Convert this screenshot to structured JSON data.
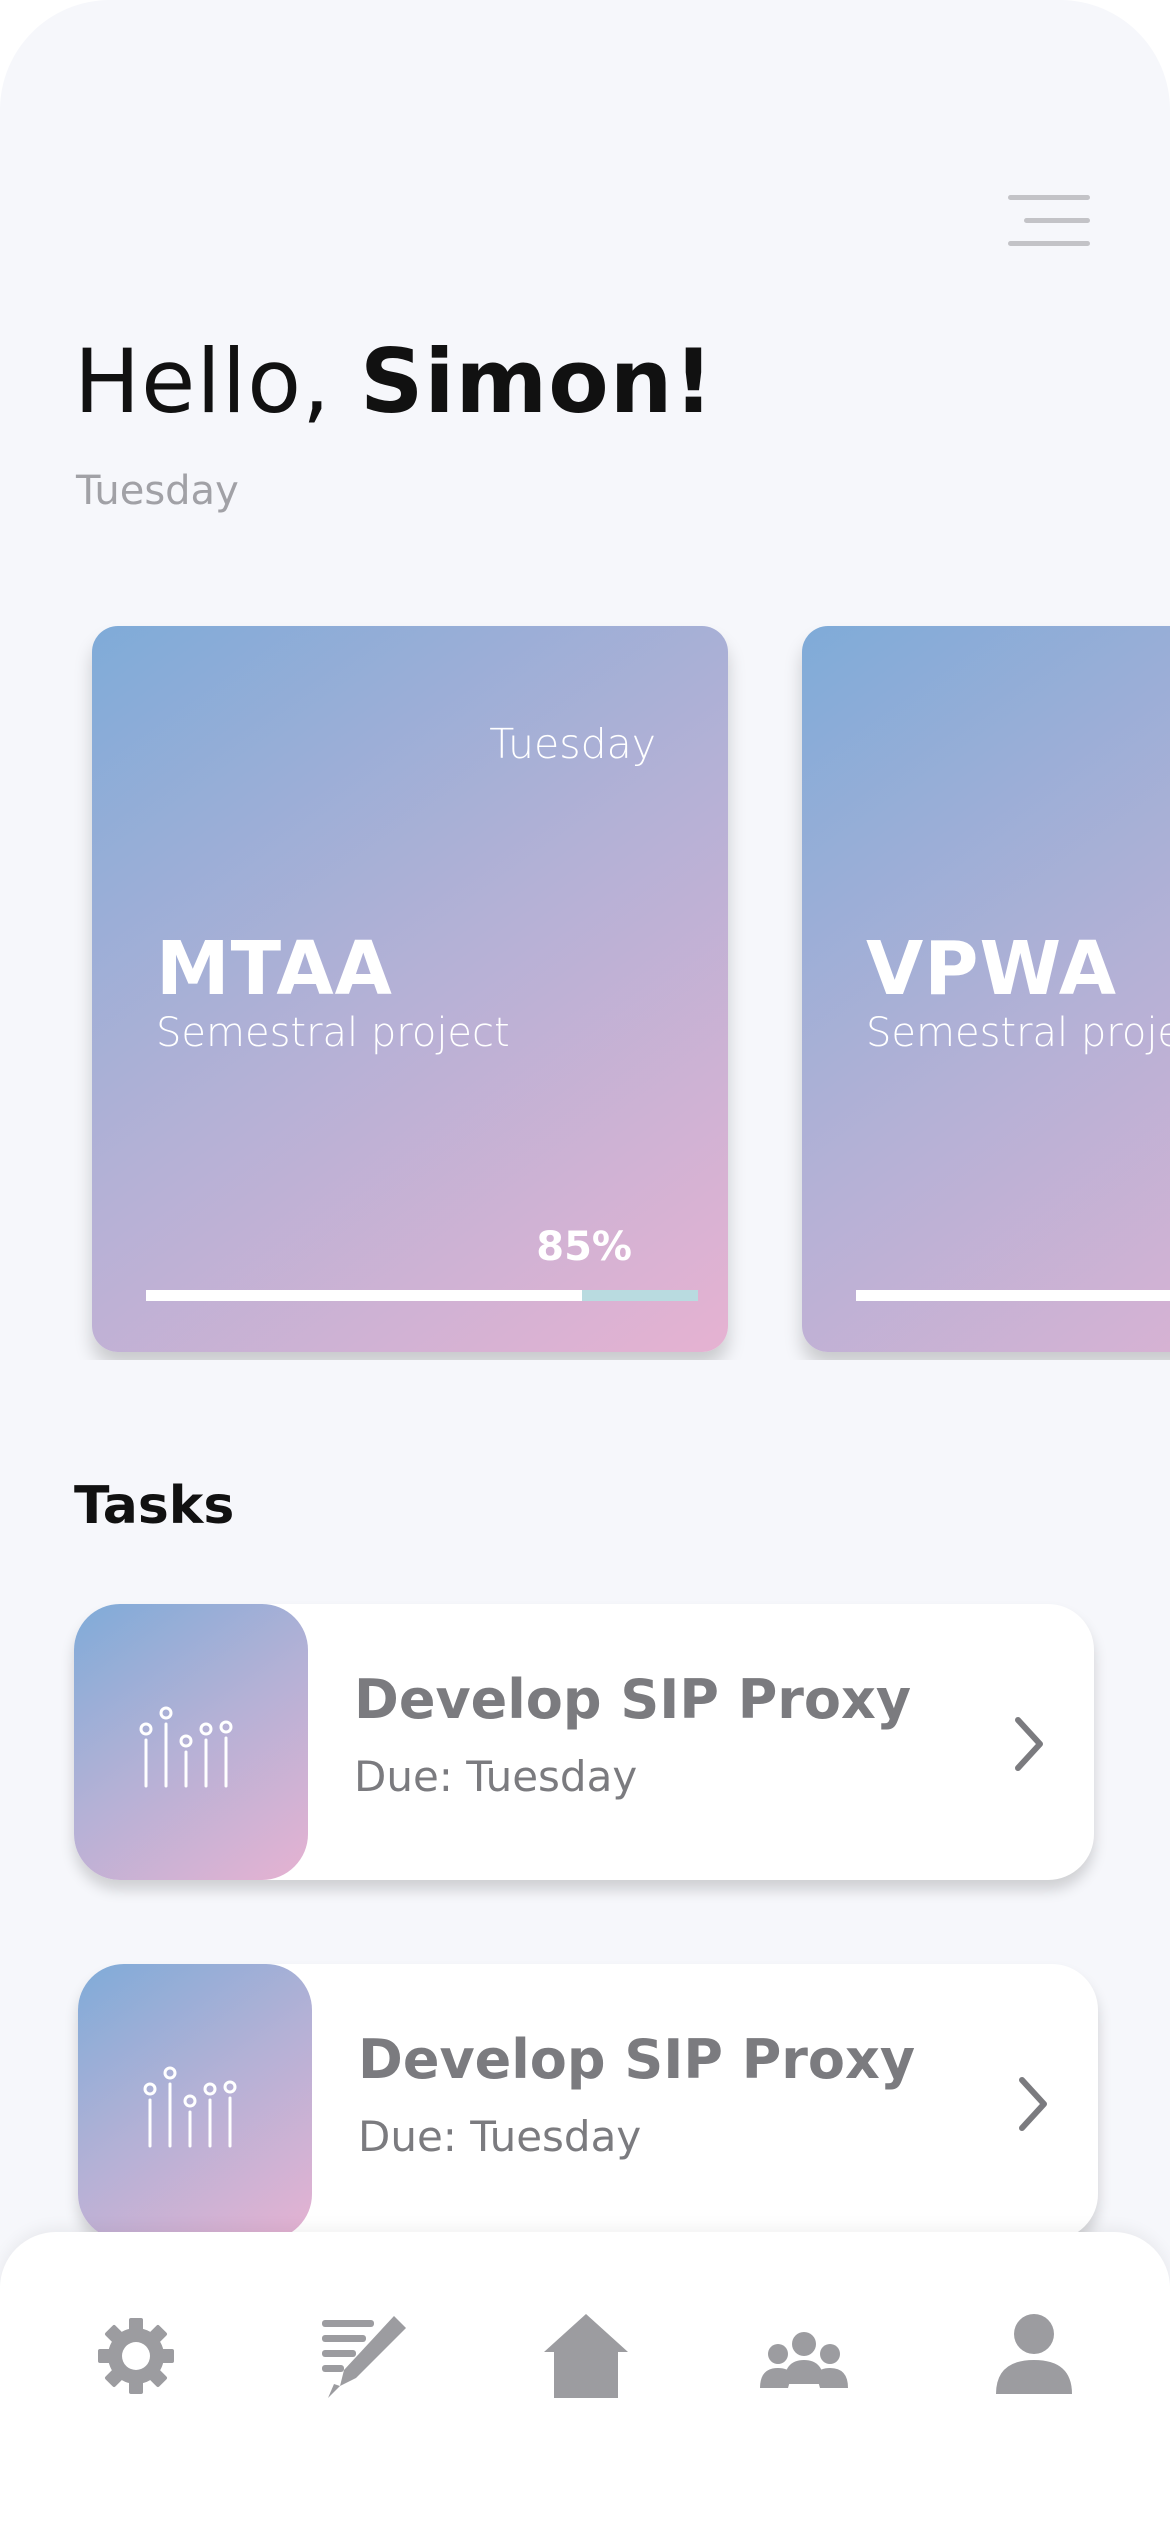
{
  "greeting": {
    "hello": "Hello, ",
    "name": "Simon!",
    "date": "Tuesday"
  },
  "projects": [
    {
      "day": "Tuesday",
      "code": "MTAA",
      "subtitle": "Semestral project",
      "progress_label": "85%",
      "progress": 0.79
    },
    {
      "day": "",
      "code": "VPWA",
      "subtitle": "Semestral project",
      "progress_label": "",
      "progress": 1.0
    }
  ],
  "tasks": {
    "title": "Tasks",
    "items": [
      {
        "name": "Develop SIP Proxy",
        "due": "Due: Tuesday"
      },
      {
        "name": "Develop SIP Proxy",
        "due": "Due: Tuesday"
      }
    ]
  },
  "nav": {
    "items": [
      {
        "icon": "gear-icon"
      },
      {
        "icon": "pencil-notes-icon"
      },
      {
        "icon": "home-icon"
      },
      {
        "icon": "group-icon"
      },
      {
        "icon": "user-icon"
      }
    ]
  },
  "colors": {
    "gradient_start": "#7fabd8",
    "gradient_end": "#e6b2d2",
    "icon_gray": "#9c9ca0",
    "background": "#f6f7fb"
  }
}
